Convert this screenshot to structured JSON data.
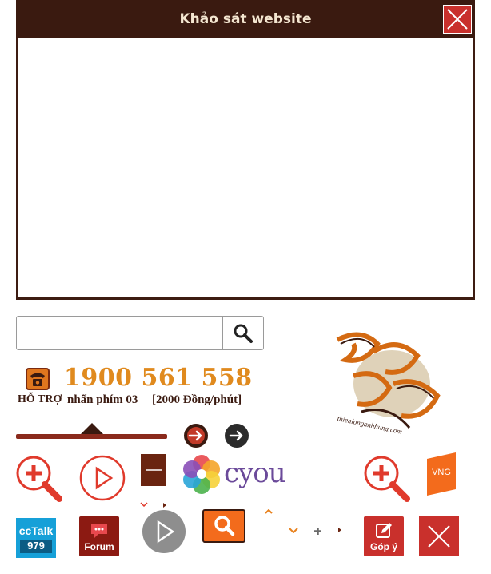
{
  "survey": {
    "title": "Khảo sát website",
    "close_icon": "close-icon"
  },
  "search": {
    "value": "",
    "placeholder": "",
    "button_icon": "search-icon"
  },
  "hotline": {
    "number": "1900 561 558",
    "support_label": "HỖ TRỢ",
    "instruction": "nhấn phím 03",
    "price": "[2000 Đồng/phút]",
    "icon": "telephone-icon"
  },
  "logo": {
    "url_text": "thienlonganhhung.com"
  },
  "partners": {
    "cyou": "cyou",
    "vng": "VNG"
  },
  "tiles": {
    "cctalk_name": "ccTalk",
    "cctalk_number": "979",
    "forum": "Forum",
    "feedback": "Góp ý"
  },
  "colors": {
    "header_bg": "#3a1a10",
    "close_red": "#c9302c",
    "accent_orange": "#e08a1e",
    "cctalk_blue": "#16a0d8",
    "forum_red": "#8c1a12",
    "vng_orange": "#f36b1c"
  }
}
